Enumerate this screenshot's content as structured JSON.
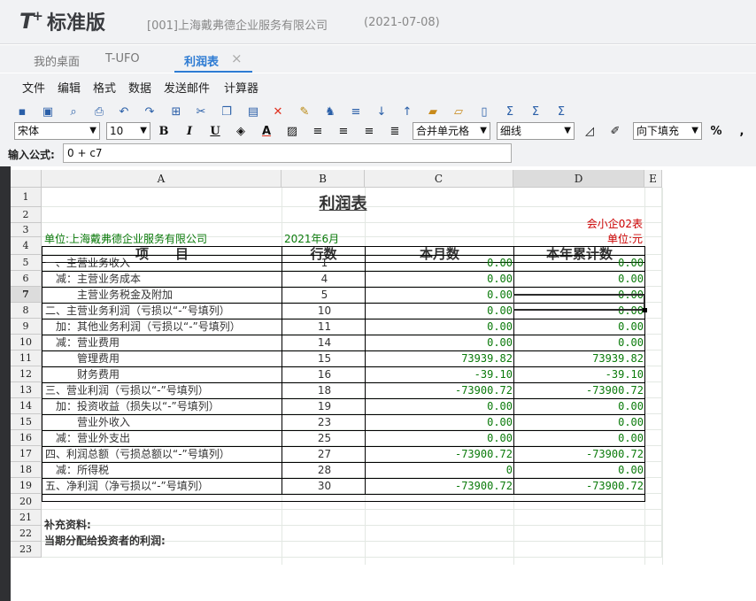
{
  "app": {
    "logo_main": "T",
    "logo_plus": "+",
    "logo_text": "标准版",
    "company": "[001]上海戴弗德企业服务有限公司",
    "date": "(2021-07-08)"
  },
  "tabs": [
    {
      "label": "我的桌面"
    },
    {
      "label": "T-UFO"
    },
    {
      "label": "利润表"
    }
  ],
  "tab_close": "×",
  "menu": [
    "文件",
    "编辑",
    "格式",
    "数据",
    "发送邮件",
    "计算器"
  ],
  "toolbar": {
    "font": "宋体",
    "font_size": "10",
    "bold": "B",
    "italic": "I",
    "underline": "U",
    "text_color": "A",
    "merge": "合并单元格",
    "line_style": "细线",
    "fill": "向下填充",
    "percent": "%",
    "comma": ","
  },
  "formula": {
    "label": "输入公式:",
    "value": "0 + c7"
  },
  "sheet": {
    "columns": [
      "A",
      "B",
      "C",
      "D",
      "E"
    ],
    "rows": [
      "1",
      "2",
      "3",
      "4",
      "5",
      "6",
      "7",
      "8",
      "9",
      "10",
      "11",
      "12",
      "13",
      "14",
      "15",
      "16",
      "17",
      "18",
      "19",
      "20",
      "21",
      "22",
      "23"
    ],
    "title": "利润表",
    "form_code": "会小企02表",
    "unit_label": "单位:上海戴弗德企业服务有限公司",
    "period": "2021年6月",
    "currency": "单位:元",
    "headers": [
      "项　　目",
      "行数",
      "本月数",
      "本年累计数"
    ],
    "lines": [
      {
        "item": "一、主营业务收入",
        "line": "1",
        "month": "0.00",
        "year": "0.00"
      },
      {
        "item": "　减：主营业务成本",
        "line": "4",
        "month": "0.00",
        "year": "0.00"
      },
      {
        "item": "　　　主营业务税金及附加",
        "line": "5",
        "month": "0.00",
        "year": "0.00"
      },
      {
        "item": "二、主营业务利润（亏损以“-”号填列）",
        "line": "10",
        "month": "0.00",
        "year": "0.00"
      },
      {
        "item": "　加：其他业务利润（亏损以“-”号填列）",
        "line": "11",
        "month": "0.00",
        "year": "0.00"
      },
      {
        "item": "　减：营业费用",
        "line": "14",
        "month": "0.00",
        "year": "0.00"
      },
      {
        "item": "　　　管理费用",
        "line": "15",
        "month": "73939.82",
        "year": "73939.82"
      },
      {
        "item": "　　　财务费用",
        "line": "16",
        "month": "-39.10",
        "year": "-39.10"
      },
      {
        "item": "三、营业利润（亏损以“-”号填列）",
        "line": "18",
        "month": "-73900.72",
        "year": "-73900.72"
      },
      {
        "item": "　加：投资收益（损失以“-”号填列）",
        "line": "19",
        "month": "0.00",
        "year": "0.00"
      },
      {
        "item": "　　　营业外收入",
        "line": "23",
        "month": "0.00",
        "year": "0.00"
      },
      {
        "item": "　减：营业外支出",
        "line": "25",
        "month": "0.00",
        "year": "0.00"
      },
      {
        "item": "四、利润总额（亏损总额以“-”号填列）",
        "line": "27",
        "month": "-73900.72",
        "year": "-73900.72"
      },
      {
        "item": "　减：所得税",
        "line": "28",
        "month": "0",
        "year": "0.00"
      },
      {
        "item": "五、净利润（净亏损以“-”号填列）",
        "line": "30",
        "month": "-73900.72",
        "year": "-73900.72"
      }
    ],
    "supplement": "补充资料:",
    "distribution": "当期分配给投资者的利润:"
  },
  "colors": {
    "accent": "#2d7bd3",
    "green_text": "#0a7a0a",
    "red_text": "#cc0000"
  }
}
